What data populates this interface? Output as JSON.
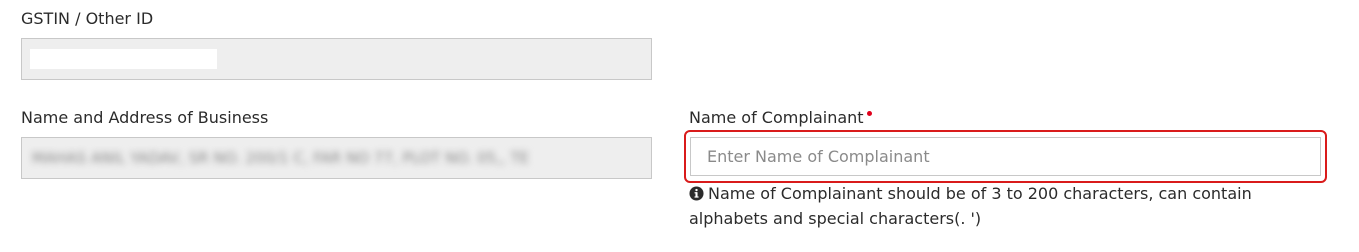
{
  "gstin": {
    "label": "GSTIN / Other ID",
    "value": ""
  },
  "business": {
    "label": "Name and Address of Business",
    "value": "MAHAS ANIL YADAV, SR NO. 200/1 C, FAR NO 77, PLOT NO. 05,, TE"
  },
  "complainant": {
    "label": "Name of Complainant",
    "required": true,
    "placeholder": "Enter Name of Complainant",
    "hint": "Name of Complainant should be of 3 to 200 characters, can contain alphabets and special characters(. ')"
  },
  "colors": {
    "error_border": "#d91b1b",
    "required_marker": "#e0001b",
    "disabled_field_bg": "#eeeeee"
  },
  "icons": {
    "hint": "info-circle-icon"
  }
}
